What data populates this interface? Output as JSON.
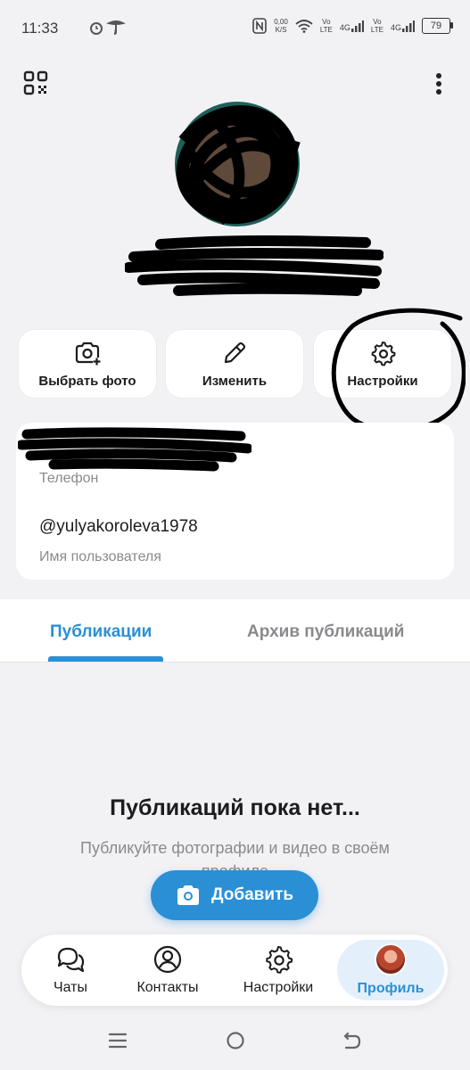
{
  "status": {
    "time": "11:33",
    "net_speed_top": "0,00",
    "net_speed_bottom": "K/S",
    "volte1_top": "Vo",
    "volte1_bottom": "LTE",
    "lte1": "4G",
    "volte2_top": "Vo",
    "volte2_bottom": "LTE",
    "lte2": "4G",
    "battery": "79"
  },
  "actions": {
    "choose_photo": "Выбрать фото",
    "edit": "Изменить",
    "settings": "Настройки"
  },
  "info": {
    "phone_label": "Телефон",
    "username": "@yulyakoroleva1978",
    "username_label": "Имя пользователя"
  },
  "tabs": [
    {
      "label": "Публикации",
      "active": true
    },
    {
      "label": "Архив публикаций",
      "active": false
    }
  ],
  "empty_state": {
    "title": "Публикаций пока нет...",
    "subtitle": "Публикуйте фотографии и видео в своём профиле"
  },
  "add_button": {
    "label": "Добавить"
  },
  "bottom_nav": [
    {
      "label": "Чаты",
      "icon": "chats-icon"
    },
    {
      "label": "Контакты",
      "icon": "contacts-icon"
    },
    {
      "label": "Настройки",
      "icon": "settings-icon"
    },
    {
      "label": "Профиль",
      "icon": "profile-avatar",
      "active": true
    }
  ],
  "colors": {
    "accent": "#2b8fd6",
    "background": "#f2f2f5",
    "card": "#ffffff",
    "muted_text": "#8a8a8e"
  }
}
